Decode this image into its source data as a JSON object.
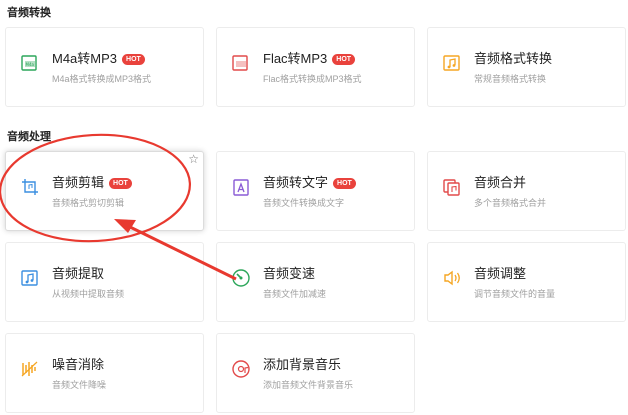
{
  "sections": {
    "conversion": "音频转换",
    "processing": "音频处理"
  },
  "cards": {
    "m4a": {
      "title": "M4a转MP3",
      "hot": "HOT",
      "desc": "M4a格式转换成MP3格式",
      "icon": "file-convert-icon",
      "color": "#2ca65a"
    },
    "flac": {
      "title": "Flac转MP3",
      "hot": "HOT",
      "desc": "Flac格式转换成MP3格式",
      "icon": "file-convert-icon",
      "color": "#e24a4a"
    },
    "format": {
      "title": "音频格式转换",
      "hot": "",
      "desc": "常规音频格式转换",
      "icon": "music-note-icon",
      "color": "#f5a623"
    },
    "cut": {
      "title": "音频剪辑",
      "hot": "HOT",
      "desc": "音频格式剪切剪辑",
      "icon": "crop-icon",
      "color": "#3b8fe0",
      "star": "☆"
    },
    "to_text": {
      "title": "音频转文字",
      "hot": "HOT",
      "desc": "音频文件转换成文字",
      "icon": "text-icon",
      "color": "#8a5bd6"
    },
    "merge": {
      "title": "音频合并",
      "hot": "",
      "desc": "多个音频格式合并",
      "icon": "merge-icon",
      "color": "#e24a4a"
    },
    "extract": {
      "title": "音频提取",
      "hot": "",
      "desc": "从视频中提取音频",
      "icon": "music-note-icon",
      "color": "#3b8fe0"
    },
    "speed": {
      "title": "音频变速",
      "hot": "",
      "desc": "音频文件加减速",
      "icon": "speed-dial-icon",
      "color": "#2ca65a"
    },
    "volume": {
      "title": "音频调整",
      "hot": "",
      "desc": "调节音频文件的音量",
      "icon": "speaker-icon",
      "color": "#f5a623"
    },
    "denoise": {
      "title": "噪音消除",
      "hot": "",
      "desc": "音频文件降噪",
      "icon": "noise-icon",
      "color": "#f5a623"
    },
    "bgm": {
      "title": "添加背景音乐",
      "hot": "",
      "desc": "添加音频文件背景音乐",
      "icon": "disc-icon",
      "color": "#e24a4a"
    }
  },
  "annotation": {
    "color": "#e8392f"
  }
}
